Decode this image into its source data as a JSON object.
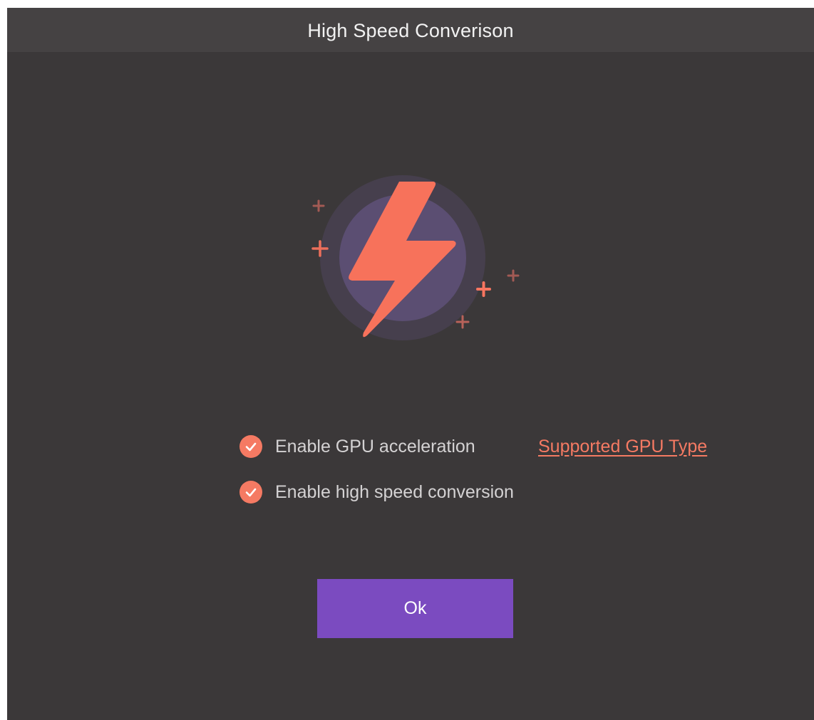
{
  "dialog": {
    "title": "High Speed Converison"
  },
  "hero": {
    "icon": "lightning-bolt-icon",
    "sparkle_icon": "plus-sparkle-icon"
  },
  "options": [
    {
      "label": "Enable GPU acceleration",
      "checked": true
    },
    {
      "label": "Enable high speed conversion",
      "checked": true
    }
  ],
  "link": {
    "label": "Supported GPU Type"
  },
  "buttons": {
    "ok_label": "Ok"
  },
  "colors": {
    "background": "#3b3839",
    "title_bar": "#454243",
    "accent": "#f57a63",
    "button": "#7b4bc0",
    "circle_outer": "#463f4d",
    "circle_inner": "#5b4e72"
  }
}
